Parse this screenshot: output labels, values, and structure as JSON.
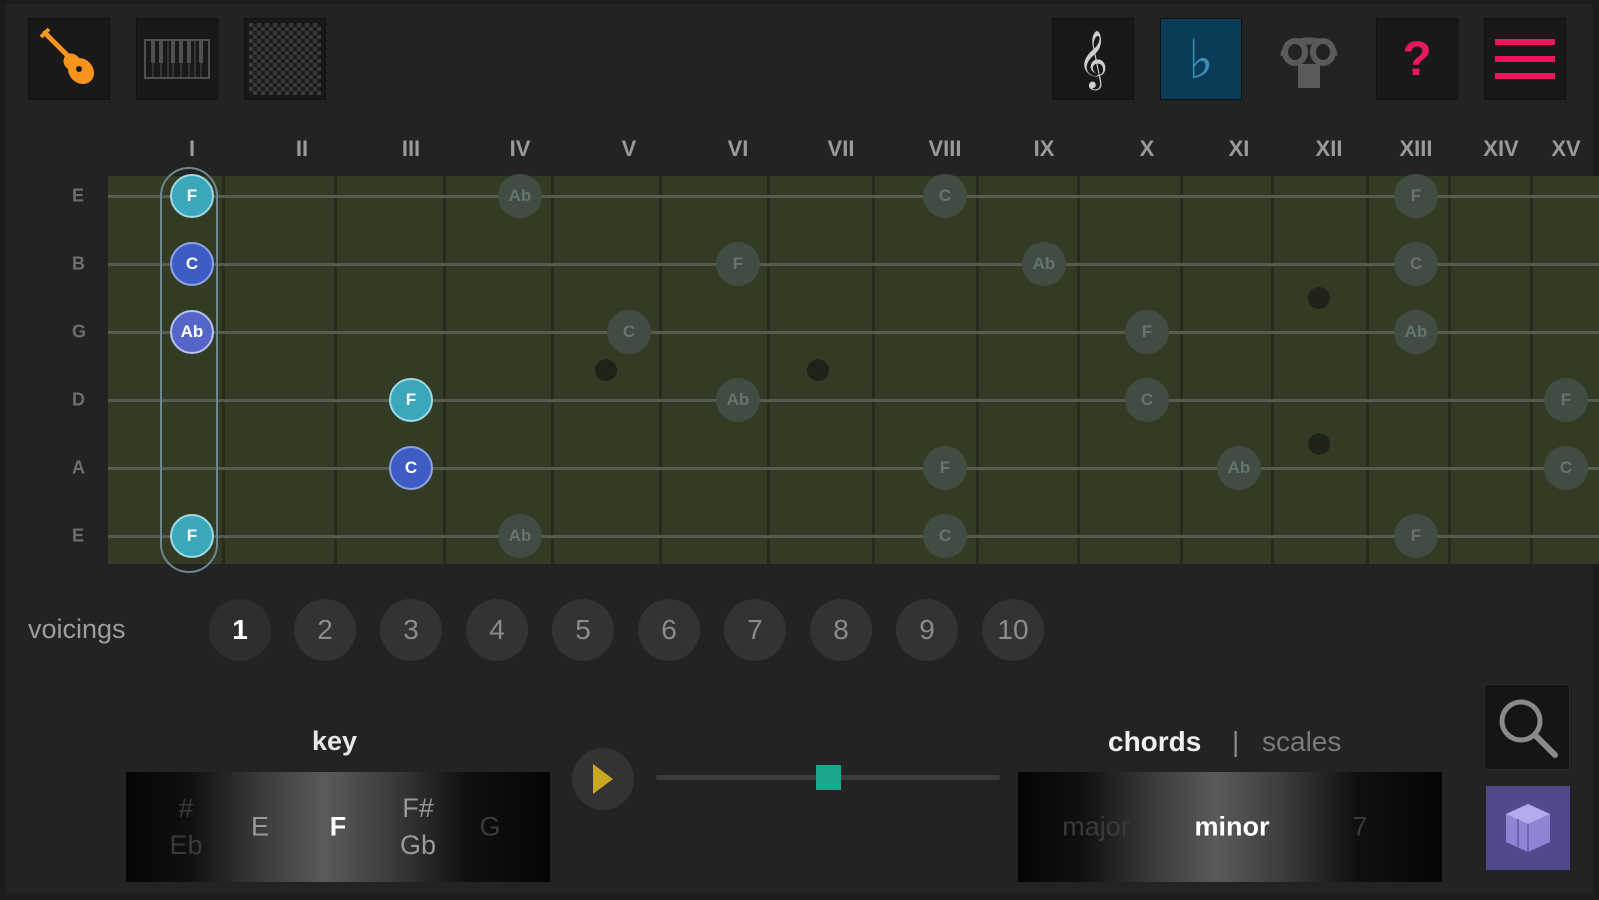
{
  "toolbar": {
    "left": [
      {
        "name": "guitar-icon",
        "active": true
      },
      {
        "name": "piano-icon",
        "active": false
      },
      {
        "name": "pattern-icon",
        "active": false
      }
    ],
    "right": [
      {
        "name": "treble-clef-icon",
        "glyph": "𝄞",
        "active": false
      },
      {
        "name": "flat-icon",
        "glyph": "♭",
        "active": true
      },
      {
        "name": "headphones-icon",
        "glyph": "",
        "active": false
      },
      {
        "name": "help-icon",
        "glyph": "?",
        "active": false
      },
      {
        "name": "menu-icon",
        "glyph": "",
        "active": false
      }
    ]
  },
  "fretboard": {
    "fret_numbers": [
      "I",
      "II",
      "III",
      "IV",
      "V",
      "VI",
      "VII",
      "VIII",
      "IX",
      "X",
      "XI",
      "XII",
      "XIII",
      "XIV",
      "XV"
    ],
    "strings": [
      "E",
      "B",
      "G",
      "D",
      "A",
      "E"
    ],
    "selected_fret": "I",
    "notes": [
      {
        "string": 0,
        "fret": 1,
        "label": "F",
        "style": "bright",
        "color": "teal"
      },
      {
        "string": 0,
        "fret": 4,
        "label": "Ab",
        "style": "dim"
      },
      {
        "string": 0,
        "fret": 8,
        "label": "C",
        "style": "dim"
      },
      {
        "string": 0,
        "fret": 13,
        "label": "F",
        "style": "dim"
      },
      {
        "string": 1,
        "fret": 1,
        "label": "C",
        "style": "bright",
        "color": "blue"
      },
      {
        "string": 1,
        "fret": 6,
        "label": "F",
        "style": "dim"
      },
      {
        "string": 1,
        "fret": 9,
        "label": "Ab",
        "style": "dim"
      },
      {
        "string": 1,
        "fret": 13,
        "label": "C",
        "style": "dim"
      },
      {
        "string": 2,
        "fret": 1,
        "label": "Ab",
        "style": "bright",
        "color": "violet"
      },
      {
        "string": 2,
        "fret": 5,
        "label": "C",
        "style": "dim"
      },
      {
        "string": 2,
        "fret": 10,
        "label": "F",
        "style": "dim"
      },
      {
        "string": 2,
        "fret": 13,
        "label": "Ab",
        "style": "dim"
      },
      {
        "string": 3,
        "fret": 3,
        "label": "F",
        "style": "bright",
        "color": "teal"
      },
      {
        "string": 3,
        "fret": 6,
        "label": "Ab",
        "style": "dim"
      },
      {
        "string": 3,
        "fret": 10,
        "label": "C",
        "style": "dim"
      },
      {
        "string": 3,
        "fret": 15,
        "label": "F",
        "style": "dim"
      },
      {
        "string": 4,
        "fret": 3,
        "label": "C",
        "style": "bright",
        "color": "blue"
      },
      {
        "string": 4,
        "fret": 8,
        "label": "F",
        "style": "dim"
      },
      {
        "string": 4,
        "fret": 11,
        "label": "Ab",
        "style": "dim"
      },
      {
        "string": 4,
        "fret": 15,
        "label": "C",
        "style": "dim"
      },
      {
        "string": 5,
        "fret": 1,
        "label": "F",
        "style": "bright",
        "color": "teal"
      },
      {
        "string": 5,
        "fret": 4,
        "label": "Ab",
        "style": "dim"
      },
      {
        "string": 5,
        "fret": 8,
        "label": "C",
        "style": "dim"
      },
      {
        "string": 5,
        "fret": 13,
        "label": "F",
        "style": "dim"
      }
    ]
  },
  "voicings": {
    "label": "voicings",
    "items": [
      "1",
      "2",
      "3",
      "4",
      "5",
      "6",
      "7",
      "8",
      "9",
      "10"
    ],
    "active": "1"
  },
  "key": {
    "title": "key",
    "items": [
      {
        "text": "#\nEb",
        "level": "faint"
      },
      {
        "text": "E",
        "level": "mid"
      },
      {
        "text": "F",
        "level": "selected"
      },
      {
        "text": "F#\nGb",
        "level": "mid"
      },
      {
        "text": "G",
        "level": "faint"
      }
    ]
  },
  "player": {
    "slider_value": 0.5
  },
  "chord_picker": {
    "tab_chords": "chords",
    "separator": "|",
    "tab_scales": "scales",
    "active_tab": "chords",
    "items": [
      {
        "text": "major",
        "level": "faint"
      },
      {
        "text": "minor",
        "level": "selected"
      },
      {
        "text": "7",
        "level": "faint"
      }
    ]
  },
  "colors": {
    "accent_orange": "#f7941d",
    "accent_pink": "#e8185f",
    "accent_flat_bg": "#0b3c57",
    "note_teal": "#3aa7bb",
    "note_blue": "#3d5cc4",
    "slider_thumb": "#19a88d",
    "play_yellow": "#c9a820"
  }
}
